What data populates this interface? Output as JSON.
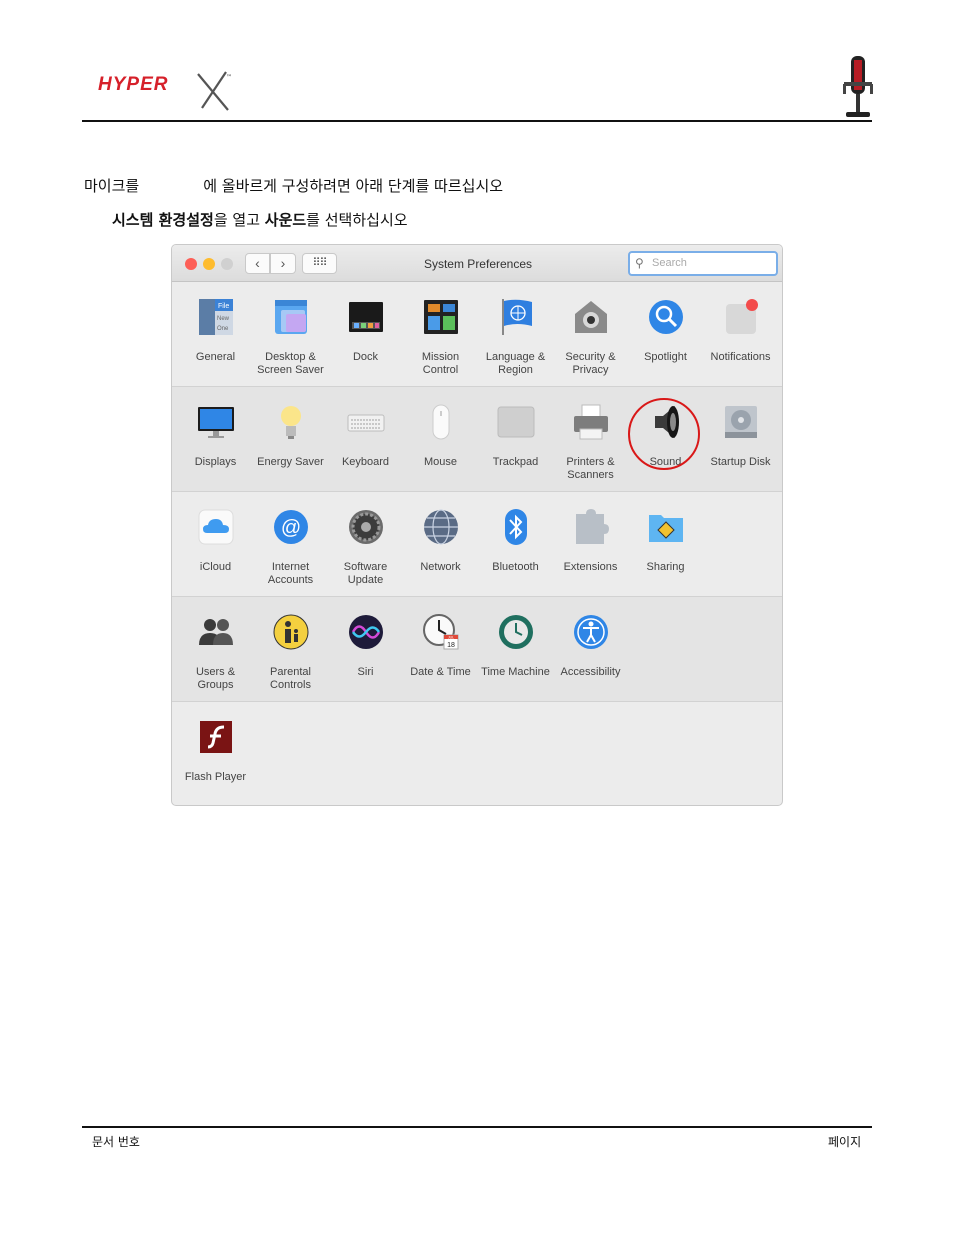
{
  "header": {
    "logo_text": "HYPERX",
    "logo_tm": "™"
  },
  "instructions": {
    "intro_part1": "마이크를",
    "intro_part2": "에 올바르게 구성하려면 아래 단계를 따르십시오",
    "step_bold1": "시스템 환경설정",
    "step_text1": "을 열고 ",
    "step_bold2": "사운드",
    "step_text2": "를 선택하십시오"
  },
  "window": {
    "title": "System Preferences",
    "search_placeholder": "Search",
    "nav_back": "‹",
    "nav_forward": "›",
    "grid_icon": "⠿⠿",
    "rows": [
      [
        "General",
        "Desktop & Screen Saver",
        "Dock",
        "Mission Control",
        "Language & Region",
        "Security & Privacy",
        "Spotlight",
        "Notifications"
      ],
      [
        "Displays",
        "Energy Saver",
        "Keyboard",
        "Mouse",
        "Trackpad",
        "Printers & Scanners",
        "Sound",
        "Startup Disk"
      ],
      [
        "iCloud",
        "Internet Accounts",
        "Software Update",
        "Network",
        "Bluetooth",
        "Extensions",
        "Sharing"
      ],
      [
        "Users & Groups",
        "Parental Controls",
        "Siri",
        "Date & Time",
        "Time Machine",
        "Accessibility"
      ],
      [
        "Flash Player"
      ]
    ],
    "general_icon_text": [
      "File",
      "New",
      "One"
    ],
    "date_icon_text": [
      "JUL",
      "18"
    ],
    "highlighted": "Sound"
  },
  "footer": {
    "left": "문서 번호",
    "right": "페이지"
  },
  "colors": {
    "accent_red": "#d91818",
    "logo_red": "#d6202a"
  }
}
